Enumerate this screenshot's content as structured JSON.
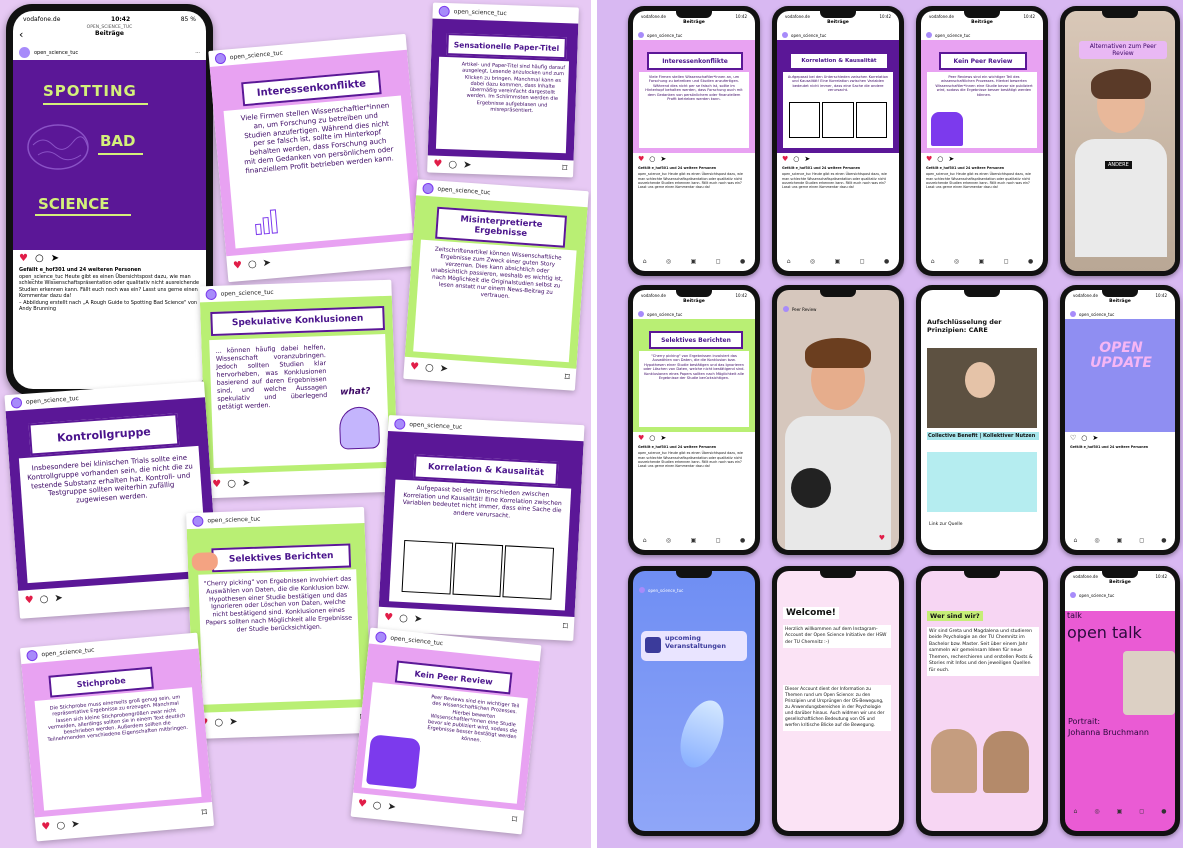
{
  "account": "open_science_tuc",
  "big_phone": {
    "carrier": "vodafone.de",
    "time": "10:42",
    "battery": "85 %",
    "account_caps": "OPEN_SCIENCE_TUC",
    "section": "Beiträge",
    "post_title_lines": [
      "SPOTTING",
      "BAD",
      "SCIENCE"
    ],
    "likes": "Gefällt e_hof301 und 24 weiteren Personen",
    "caption": "open_science_tuc Heute gibt es einen Übersichtspost dazu, wie man schlechte Wissenschaftspräsentation oder qualitativ nicht ausreichende Studien erkennen kann. Fällt euch noch was ein? Lasst uns gerne einen Kommentar dazu da!",
    "credit": "– Abbildung erstellt nach „A Rough Guide to Spotting Bad Science\" von Andy Brunning"
  },
  "cards": {
    "interessen": {
      "title": "Interessenkonflikte",
      "text": "Viele Firmen stellen Wissenschaftler*innen an, um Forschung zu betreiben und Studien anzufertigen. Während dies nicht per se falsch ist, sollte im Hinterkopf behalten werden, dass Forschung auch mit dem Gedanken von persönlichem oder finanziellem Profit betrieben werden kann."
    },
    "paper_titel": {
      "title": "Sensationelle Paper-Titel",
      "text": "Artikel- und Paper-Titel sind häufig darauf ausgelegt, Lesende anzulocken und zum Klicken zu bringen. Manchmal kann es dabei dazu kommen, dass Inhalte übermäßig vereinfacht dargestellt werden. Im Schlimmsten werden die Ergebnisse aufgeblasen und misrepräsentiert."
    },
    "misinterpretiert": {
      "title": "Misinterpretierte Ergebnisse",
      "text": "Zeitschriftenartikel können Wissenschaftliche Ergebnisse zum Zweck einer guten Story verzerren. Dies kann absichtlich oder unabsichtlich passieren, weshalb es wichtig ist, nach Möglichkeit die Originalstudien selbst zu lesen anstatt nur einem News-Beitrag zu vertrauen."
    },
    "spekulativ": {
      "title": "Spekulative Konklusionen",
      "text": "... können häufig dabei helfen, Wissenschaft voranzubringen. Jedoch sollten Studien klar hervorheben, was Konklusionen basierend auf deren Ergebnissen sind, und welche Aussagen spekulativ und überlegend getätigt werden.",
      "bubble": "what?"
    },
    "kontroll": {
      "title": "Kontrollgruppe",
      "text": "Insbesondere bei klinischen Trials sollte eine Kontrollgruppe vorhanden sein, die nicht die zu testende Substanz erhalten hat. Kontroll- und Testgruppe sollten weiterhin zufällig zugewiesen werden."
    },
    "korrelation": {
      "title": "Korrelation & Kausalität",
      "text": "Aufgepasst bei den Unterschieden zwischen Korrelation und Kausalität! Eine Korrelation zwischen Variablen bedeutet nicht immer, dass eine Sache die andere verursacht."
    },
    "selektiv": {
      "title": "Selektives Berichten",
      "text": "\"Cherry picking\" von Ergebnissen involviert das Auswählen von Daten, die die Konklusion bzw. Hypothesen einer Studie bestätigen und das Ignorieren oder Löschen von Daten, welche nicht bestätigend sind. Konklusionen eines Papers sollten nach Möglichkeit alle Ergebnisse der Studie berücksichtigen."
    },
    "stichprobe": {
      "title": "Stichprobe",
      "text": "Die Stichprobe muss einerseits groß genug sein, um repräsentative Ergebnisse zu erzeugen. Manchmal lassen sich kleine Stichprobengrößen zwar nicht vermeiden, allerdings sollten sie in einem Text deutlich beschrieben werden. Außerdem sollten die Teilnehmenden verschiedene Eigenschaften mitbringen."
    },
    "peer": {
      "title": "Kein Peer Review",
      "text": "Peer Reviews sind ein wichtiger Teil des wissenschaftlichen Prozesses. Hierbei bewerten Wissenschaftler*innen eine Studie bevor sie publiziert wird, sodass die Ergebnisse besser bestätigt werden können."
    }
  },
  "right_phones": {
    "carrier": "vodafone.de",
    "time": "10:42",
    "section": "Beiträge",
    "likes": "Gefällt e_hof301 und 24 weitere Personen",
    "p1_title": "Interessenkonflikte",
    "p2_title": "Korrelation & Kausalität",
    "p3_title": "Kein Peer Review",
    "p4_title": "Alternativen zum Peer Review",
    "p4_shirt": "ANDERE",
    "p5_title": "Selektives Berichten",
    "p6_user": "Peer Review",
    "p7_title": "Aufschlüsselung der Prinzipien: CARE",
    "p7_sub": "Collective Benefit | Kollektiver Nutzen",
    "p7_link": "Link zur Quelle",
    "p8_title": "OPEN UPDATE",
    "p9_title": "upcoming Veranstaltungen",
    "p10_title": "Welcome!",
    "p10_text": "Herzlich willkommen auf dem Instagram-Account der Open Science Initiative der HSW der TU Chemnitz :-)",
    "p10_text2": "Dieser Account dient der Information zu Themen rund um Open Science: zu den Prinzipien und Ursprüngen der OS-Bewegung, zu Anwendungsbereichen in der Psychologie und darüber hinaus. Auch widmen wir uns der gesellschaftlichen Bedeutung von OS und werfen kritische Blicke auf die Bewegung.",
    "p11_title": "Wer sind wir?",
    "p11_text": "Wir sind Greta und Magdalena und studieren beide Psychologie an der TU Chemnitz im Bachelor bzw. Master. Seit über einem Jahr sammeln wir gemeinsam Ideen für neue Themen, recherchieren und erstellen Posts & Stories mit Infos und den jeweiligen Quellen für euch.",
    "p12_talk": "talk",
    "p12_title": "open talk",
    "p12_sub": "Portrait:",
    "p12_name": "Johanna Bruchmann"
  },
  "colors": {
    "purple": "#5b1797",
    "pink": "#e8a2f2",
    "green": "#b9ef74",
    "accent_blue": "#1d9bf0",
    "heart": "#e11d48"
  }
}
